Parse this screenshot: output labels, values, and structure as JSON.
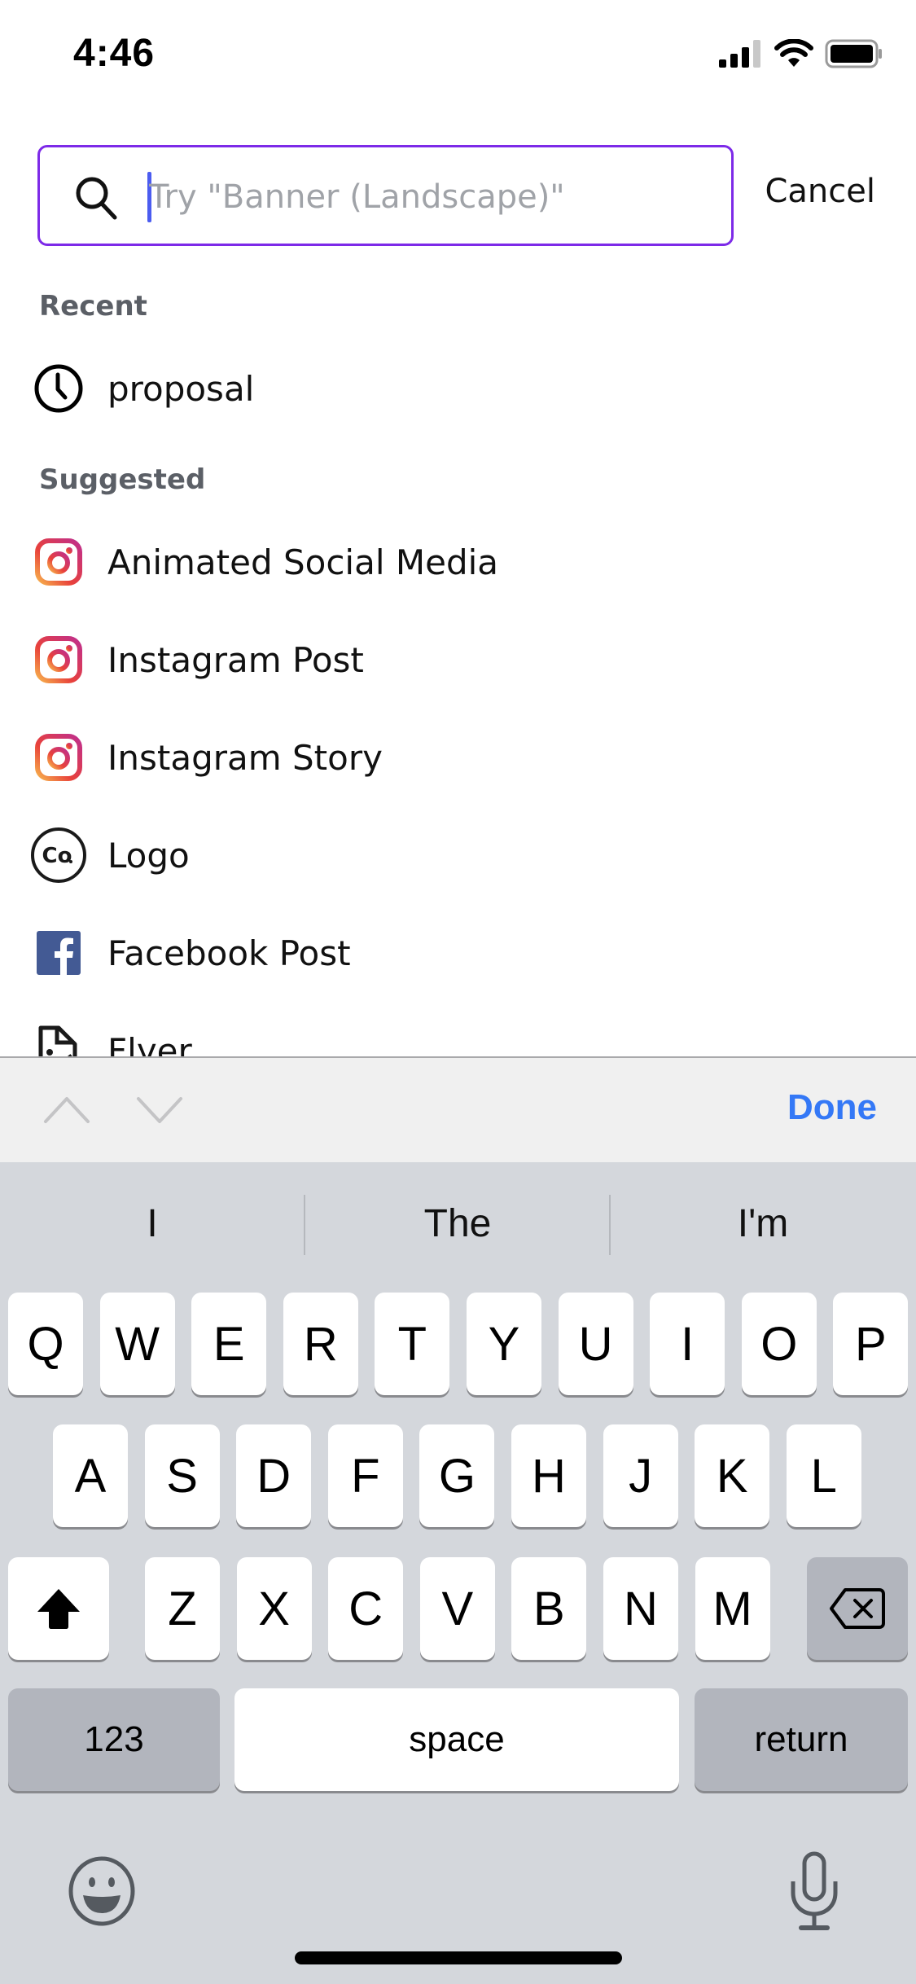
{
  "status_bar": {
    "time": "4:46",
    "icons": [
      "cellular-signal-icon",
      "wifi-icon",
      "battery-icon"
    ]
  },
  "search": {
    "placeholder": "Try \"Banner (Landscape)\"",
    "value": "",
    "icon": "search-icon",
    "cancel_label": "Cancel",
    "border_color": "#7d2ae8"
  },
  "recent": {
    "header": "Recent",
    "items": [
      {
        "label": "proposal",
        "icon": "clock-icon"
      }
    ]
  },
  "suggested": {
    "header": "Suggested",
    "items": [
      {
        "label": "Animated Social Media",
        "icon": "instagram-icon"
      },
      {
        "label": "Instagram Post",
        "icon": "instagram-icon"
      },
      {
        "label": "Instagram Story",
        "icon": "instagram-icon"
      },
      {
        "label": "Logo",
        "icon": "logo-co-icon"
      },
      {
        "label": "Facebook Post",
        "icon": "facebook-icon"
      },
      {
        "label": "Flyer",
        "icon": "flyer-icon"
      }
    ]
  },
  "accessory_bar": {
    "prev_icon": "chevron-up-icon",
    "next_icon": "chevron-down-icon",
    "done_label": "Done",
    "done_color": "#3478f6"
  },
  "keyboard": {
    "suggestions": [
      "I",
      "The",
      "I'm"
    ],
    "row1": [
      "Q",
      "W",
      "E",
      "R",
      "T",
      "Y",
      "U",
      "I",
      "O",
      "P"
    ],
    "row2": [
      "A",
      "S",
      "D",
      "F",
      "G",
      "H",
      "J",
      "K",
      "L"
    ],
    "row3": [
      "Z",
      "X",
      "C",
      "V",
      "B",
      "N",
      "M"
    ],
    "numbers_label": "123",
    "space_label": "space",
    "return_label": "return",
    "shift_icon": "shift-icon",
    "delete_icon": "backspace-icon",
    "emoji_icon": "emoji-icon",
    "mic_icon": "microphone-icon"
  }
}
